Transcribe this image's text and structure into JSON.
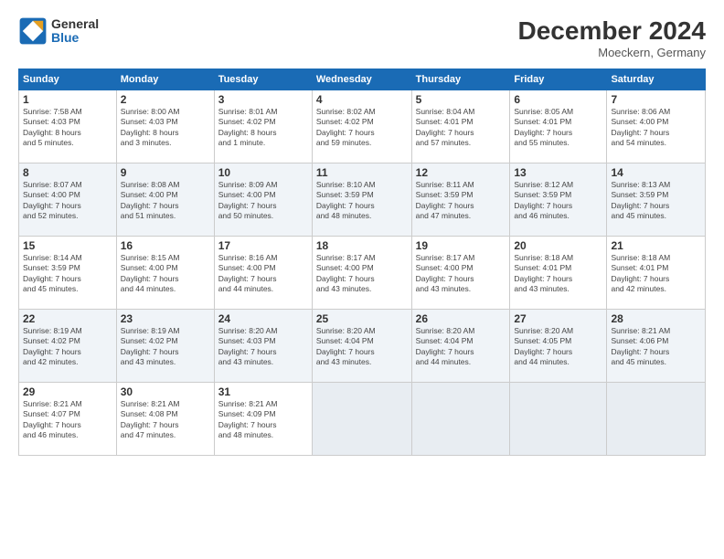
{
  "header": {
    "logo_general": "General",
    "logo_blue": "Blue",
    "month_year": "December 2024",
    "location": "Moeckern, Germany"
  },
  "days_of_week": [
    "Sunday",
    "Monday",
    "Tuesday",
    "Wednesday",
    "Thursday",
    "Friday",
    "Saturday"
  ],
  "weeks": [
    [
      {
        "day": "1",
        "info": "Sunrise: 7:58 AM\nSunset: 4:03 PM\nDaylight: 8 hours\nand 5 minutes."
      },
      {
        "day": "2",
        "info": "Sunrise: 8:00 AM\nSunset: 4:03 PM\nDaylight: 8 hours\nand 3 minutes."
      },
      {
        "day": "3",
        "info": "Sunrise: 8:01 AM\nSunset: 4:02 PM\nDaylight: 8 hours\nand 1 minute."
      },
      {
        "day": "4",
        "info": "Sunrise: 8:02 AM\nSunset: 4:02 PM\nDaylight: 7 hours\nand 59 minutes."
      },
      {
        "day": "5",
        "info": "Sunrise: 8:04 AM\nSunset: 4:01 PM\nDaylight: 7 hours\nand 57 minutes."
      },
      {
        "day": "6",
        "info": "Sunrise: 8:05 AM\nSunset: 4:01 PM\nDaylight: 7 hours\nand 55 minutes."
      },
      {
        "day": "7",
        "info": "Sunrise: 8:06 AM\nSunset: 4:00 PM\nDaylight: 7 hours\nand 54 minutes."
      }
    ],
    [
      {
        "day": "8",
        "info": "Sunrise: 8:07 AM\nSunset: 4:00 PM\nDaylight: 7 hours\nand 52 minutes."
      },
      {
        "day": "9",
        "info": "Sunrise: 8:08 AM\nSunset: 4:00 PM\nDaylight: 7 hours\nand 51 minutes."
      },
      {
        "day": "10",
        "info": "Sunrise: 8:09 AM\nSunset: 4:00 PM\nDaylight: 7 hours\nand 50 minutes."
      },
      {
        "day": "11",
        "info": "Sunrise: 8:10 AM\nSunset: 3:59 PM\nDaylight: 7 hours\nand 48 minutes."
      },
      {
        "day": "12",
        "info": "Sunrise: 8:11 AM\nSunset: 3:59 PM\nDaylight: 7 hours\nand 47 minutes."
      },
      {
        "day": "13",
        "info": "Sunrise: 8:12 AM\nSunset: 3:59 PM\nDaylight: 7 hours\nand 46 minutes."
      },
      {
        "day": "14",
        "info": "Sunrise: 8:13 AM\nSunset: 3:59 PM\nDaylight: 7 hours\nand 45 minutes."
      }
    ],
    [
      {
        "day": "15",
        "info": "Sunrise: 8:14 AM\nSunset: 3:59 PM\nDaylight: 7 hours\nand 45 minutes."
      },
      {
        "day": "16",
        "info": "Sunrise: 8:15 AM\nSunset: 4:00 PM\nDaylight: 7 hours\nand 44 minutes."
      },
      {
        "day": "17",
        "info": "Sunrise: 8:16 AM\nSunset: 4:00 PM\nDaylight: 7 hours\nand 44 minutes."
      },
      {
        "day": "18",
        "info": "Sunrise: 8:17 AM\nSunset: 4:00 PM\nDaylight: 7 hours\nand 43 minutes."
      },
      {
        "day": "19",
        "info": "Sunrise: 8:17 AM\nSunset: 4:00 PM\nDaylight: 7 hours\nand 43 minutes."
      },
      {
        "day": "20",
        "info": "Sunrise: 8:18 AM\nSunset: 4:01 PM\nDaylight: 7 hours\nand 43 minutes."
      },
      {
        "day": "21",
        "info": "Sunrise: 8:18 AM\nSunset: 4:01 PM\nDaylight: 7 hours\nand 42 minutes."
      }
    ],
    [
      {
        "day": "22",
        "info": "Sunrise: 8:19 AM\nSunset: 4:02 PM\nDaylight: 7 hours\nand 42 minutes."
      },
      {
        "day": "23",
        "info": "Sunrise: 8:19 AM\nSunset: 4:02 PM\nDaylight: 7 hours\nand 43 minutes."
      },
      {
        "day": "24",
        "info": "Sunrise: 8:20 AM\nSunset: 4:03 PM\nDaylight: 7 hours\nand 43 minutes."
      },
      {
        "day": "25",
        "info": "Sunrise: 8:20 AM\nSunset: 4:04 PM\nDaylight: 7 hours\nand 43 minutes."
      },
      {
        "day": "26",
        "info": "Sunrise: 8:20 AM\nSunset: 4:04 PM\nDaylight: 7 hours\nand 44 minutes."
      },
      {
        "day": "27",
        "info": "Sunrise: 8:20 AM\nSunset: 4:05 PM\nDaylight: 7 hours\nand 44 minutes."
      },
      {
        "day": "28",
        "info": "Sunrise: 8:21 AM\nSunset: 4:06 PM\nDaylight: 7 hours\nand 45 minutes."
      }
    ],
    [
      {
        "day": "29",
        "info": "Sunrise: 8:21 AM\nSunset: 4:07 PM\nDaylight: 7 hours\nand 46 minutes."
      },
      {
        "day": "30",
        "info": "Sunrise: 8:21 AM\nSunset: 4:08 PM\nDaylight: 7 hours\nand 47 minutes."
      },
      {
        "day": "31",
        "info": "Sunrise: 8:21 AM\nSunset: 4:09 PM\nDaylight: 7 hours\nand 48 minutes."
      },
      null,
      null,
      null,
      null
    ]
  ]
}
